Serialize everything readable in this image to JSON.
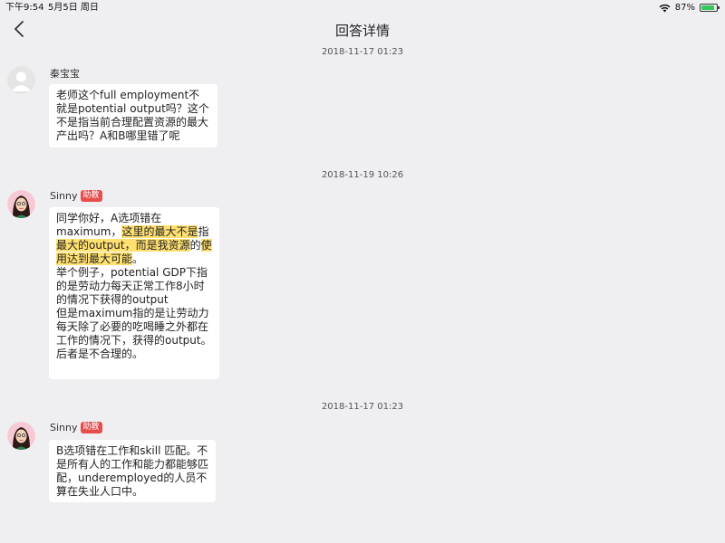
{
  "status_bar": {
    "time": "下午9:54",
    "date": "5月5日 周日",
    "battery": "87%",
    "battery_level": 0.87
  },
  "nav": {
    "title": "回答详情"
  },
  "messages": [
    {
      "timestamp": "2018-11-17 01:23",
      "author": "秦宝宝",
      "text": "老师这个full employment不就是potential output吗？这个不是指当前合理配置资源的最大产出吗？A和B哪里错了呢"
    },
    {
      "timestamp": "2018-11-19 10:26",
      "author": "Sinny",
      "badge": "助教",
      "text_pre": "同学你好，A选项错在maximum，",
      "text_highlight_1": "这里的最大不是",
      "text_mid": "指",
      "text_highlight_2": "最大的output，而是我资源",
      "text_mid2": "的",
      "text_highlight_3": "使用达到最大可能",
      "text_post": "。\n举个例子，potential GDP下指的是劳动力每天正常工作8小时的情况下获得的output\n但是maximum指的是让劳动力每天除了必要的吃喝睡之外都在工作的情况下，获得的output。\n后者是不合理的。"
    },
    {
      "timestamp": "2018-11-17 01:23",
      "author": "Sinny",
      "badge": "助教",
      "text": "B选项错在工作和skill 匹配。不是所有人的工作和能力都能够匹配，underemployed的人员不算在失业人口中。"
    }
  ]
}
